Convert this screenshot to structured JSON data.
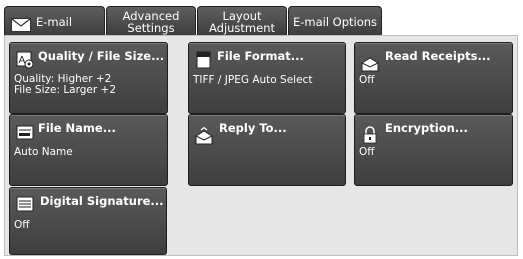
{
  "tabs": [
    {
      "label": "E-mail"
    },
    {
      "label": "Advanced\nSettings"
    },
    {
      "label": "Layout\nAdjustment"
    },
    {
      "label": "E-mail Options"
    }
  ],
  "options": {
    "quality": {
      "title": "Quality / File Size...",
      "value_line1": "Quality: Higher +2",
      "value_line2": "File Size: Larger +2"
    },
    "file_format": {
      "title": "File Format...",
      "value": "TIFF / JPEG Auto Select"
    },
    "read_receipts": {
      "title": "Read Receipts...",
      "value": "Off"
    },
    "file_name": {
      "title": "File Name...",
      "value": "Auto Name"
    },
    "reply_to": {
      "title": "Reply To..."
    },
    "encryption": {
      "title": "Encryption...",
      "value": "Off"
    },
    "digital_signature": {
      "title": "Digital Signature...",
      "value": "Off"
    }
  }
}
